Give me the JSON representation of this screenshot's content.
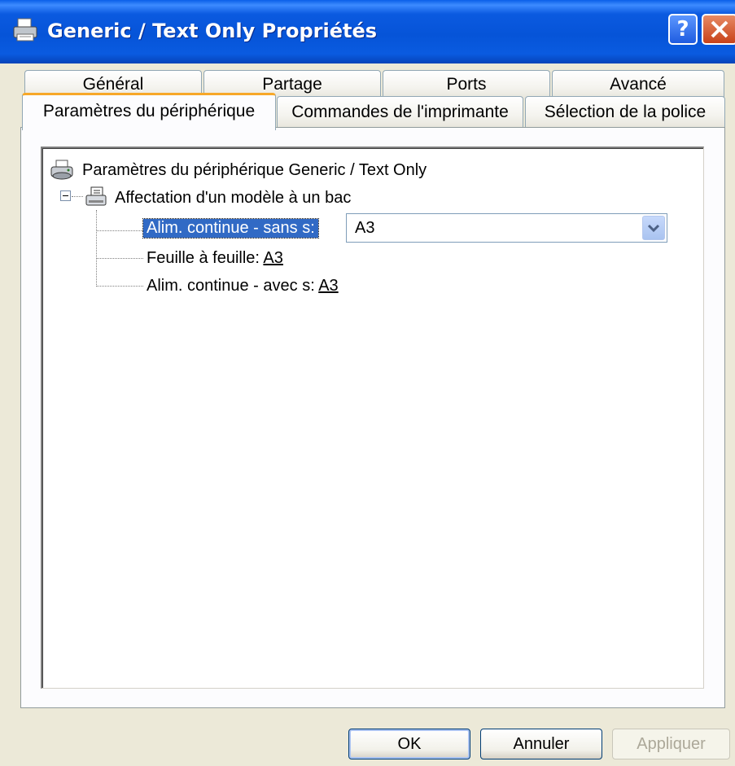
{
  "window": {
    "title": "Generic / Text Only Propriétés",
    "help_label": "?",
    "accent": "#0654D8"
  },
  "tabs_row1": [
    {
      "label": "Général"
    },
    {
      "label": "Partage"
    },
    {
      "label": "Ports"
    },
    {
      "label": "Avancé"
    }
  ],
  "tabs_row2": [
    {
      "label": "Paramètres du périphérique",
      "selected": true
    },
    {
      "label": "Commandes de l'imprimante"
    },
    {
      "label": "Sélection de la police"
    }
  ],
  "tree": {
    "root_label": "Paramètres du périphérique Generic / Text Only",
    "node_label": "Affectation d'un modèle à un bac",
    "item1": {
      "label": "Alim. continue - sans s:",
      "value": "A3"
    },
    "item2": {
      "label": "Feuille à feuille:",
      "value": "A3"
    },
    "item3": {
      "label": "Alim. continue - avec s:",
      "value": "A3"
    }
  },
  "buttons": {
    "ok": "OK",
    "cancel": "Annuler",
    "apply": "Appliquer"
  }
}
